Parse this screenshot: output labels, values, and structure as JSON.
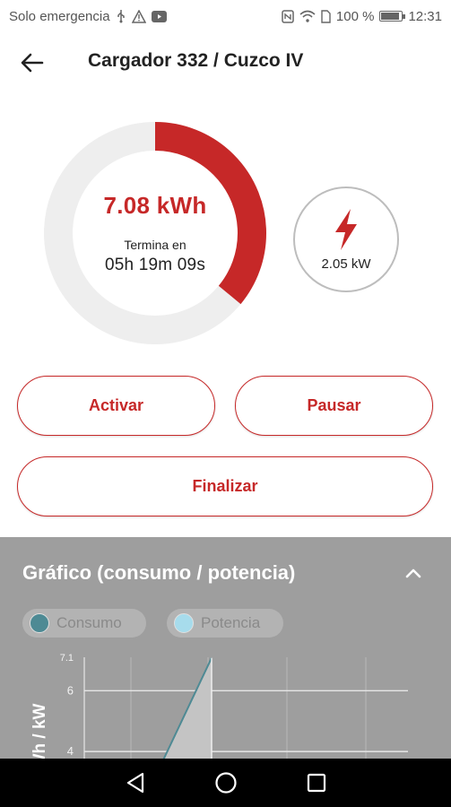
{
  "status_bar": {
    "carrier": "Solo emergencia",
    "battery": "100 %",
    "battery_level": 1.0,
    "time": "12:31",
    "icons_left": [
      "usb-icon",
      "warning-icon",
      "youtube-icon"
    ],
    "icons_right": [
      "nfc-icon",
      "wifi-icon",
      "sim-icon",
      "battery-icon"
    ]
  },
  "header": {
    "title": "Cargador 332 / Cuzco IV",
    "back_icon": "arrow-back-icon"
  },
  "charge": {
    "energy": "7.08 kWh",
    "ends_label": "Termina en",
    "remaining": "05h 19m 09s",
    "progress_fraction": 0.36,
    "progress_color": "#c62828",
    "track_color": "#eeeeee"
  },
  "power": {
    "value": "2.05",
    "unit": "kW",
    "icon": "lightning-icon"
  },
  "actions": {
    "activate": "Activar",
    "pause": "Pausar",
    "finish": "Finalizar"
  },
  "chart_panel": {
    "title": "Gráfico (consumo / potencia)",
    "collapse_icon": "chevron-up-icon",
    "legend": [
      {
        "name": "Consumo",
        "color": "#4e8a94"
      },
      {
        "name": "Potencia",
        "color": "#a7dcec"
      }
    ]
  },
  "chart_data": {
    "type": "area",
    "ylabel": "kWh / kW",
    "yticks": [
      "7.1",
      "6",
      "4"
    ],
    "ylim": [
      2.5,
      7.1
    ],
    "series": [
      {
        "name": "Consumo",
        "points": [
          [
            0.0,
            1.6
          ],
          [
            1.0,
            7.08
          ]
        ]
      },
      {
        "name": "Potencia",
        "points": [
          [
            0.0,
            2.05
          ],
          [
            1.0,
            2.05
          ]
        ]
      }
    ],
    "grid": true
  },
  "nav": {
    "back_icon": "nav-back-icon",
    "home_icon": "nav-home-icon",
    "recents_icon": "nav-recents-icon"
  }
}
